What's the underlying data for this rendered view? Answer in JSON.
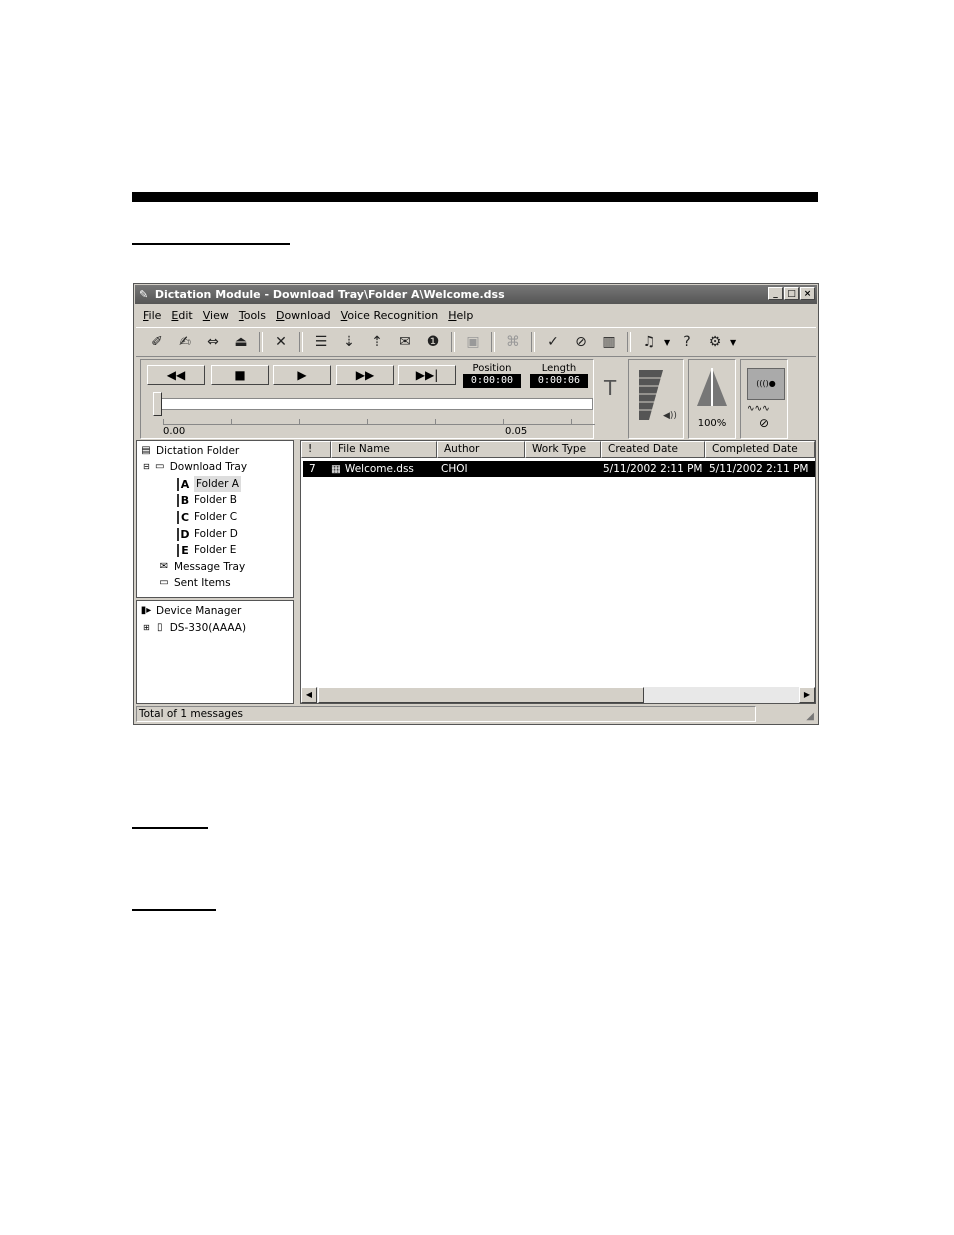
{
  "window": {
    "title": "Dictation Module - Download Tray\\Folder A\\Welcome.dss",
    "controls": [
      "_",
      "□",
      "×"
    ]
  },
  "menu": [
    "File",
    "Edit",
    "View",
    "Tools",
    "Download",
    "Voice Recognition",
    "Help"
  ],
  "toolbar": {
    "icons": [
      "record-icon",
      "insert-record-icon",
      "edit-icon",
      "eject-icon",
      "delete-icon",
      "properties-icon",
      "download-icon",
      "upload-icon",
      "mail-icon",
      "priority-icon",
      "print-icon",
      "lock-icon",
      "check-icon",
      "finish-icon",
      "book-icon",
      "voice-icon",
      "help-icon",
      "settings-icon"
    ]
  },
  "transport": {
    "rewind": "◀◀",
    "stop": "■",
    "play": "▶",
    "fast_forward": "▶▶",
    "end": "▶▶|",
    "position_label": "Position",
    "position_value": "0:00:00",
    "length_label": "Length",
    "length_value": "0:00:06",
    "scale_start": "0.00",
    "scale_mid": "0.05",
    "playback_speed": "100%"
  },
  "tree_folders": {
    "root": "Dictation Folder",
    "download_tray": "Download Tray",
    "folders": [
      "Folder A",
      "Folder B",
      "Folder C",
      "Folder D",
      "Folder E"
    ],
    "folder_letters": [
      "A",
      "B",
      "C",
      "D",
      "E"
    ],
    "message_tray": "Message Tray",
    "sent_items": "Sent Items"
  },
  "tree_devices": {
    "root": "Device Manager",
    "device": "DS-330(AAAA)"
  },
  "list": {
    "headers": [
      "!",
      "File Name",
      "Author",
      "Work Type",
      "Created Date",
      "Completed Date"
    ],
    "rows": [
      {
        "priority": "7",
        "file_name": "Welcome.dss",
        "author": "CHOI",
        "work_type": "",
        "created": "5/11/2002 2:11 PM",
        "completed": "5/11/2002 2:11 PM"
      }
    ]
  },
  "status": {
    "text": "Total of 1 messages"
  }
}
